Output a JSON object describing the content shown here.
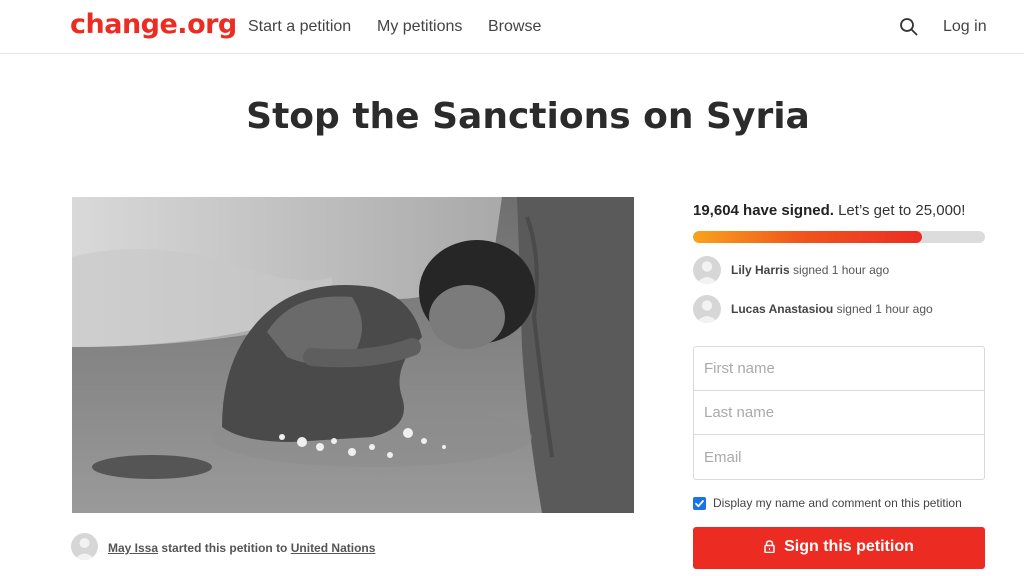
{
  "header": {
    "logo": "change.org",
    "nav": {
      "start": "Start a petition",
      "mine": "My petitions",
      "browse": "Browse"
    },
    "search_icon": "search-icon",
    "login": "Log in"
  },
  "petition": {
    "title": "Stop the Sanctions on Syria",
    "starter_name": "May Issa",
    "starter_middle": "started this petition to",
    "target": "United Nations"
  },
  "signatures": {
    "count_text": "19,604 have signed.",
    "goal_text": "Let’s get to 25,000!",
    "signed": 19604,
    "goal": 25000,
    "recent": [
      {
        "name": "Lily Harris",
        "time": "signed 1 hour ago"
      },
      {
        "name": "Lucas Anastasiou",
        "time": "signed 1 hour ago"
      }
    ]
  },
  "form": {
    "first_name_placeholder": "First name",
    "last_name_placeholder": "Last name",
    "email_placeholder": "Email",
    "consent_label": "Display my name and comment on this petition",
    "consent_checked": true,
    "submit_label": "Sign this petition"
  },
  "colors": {
    "brand": "#ec2c22",
    "progress_start": "#f8a31b",
    "checkbox": "#1a73e8"
  }
}
